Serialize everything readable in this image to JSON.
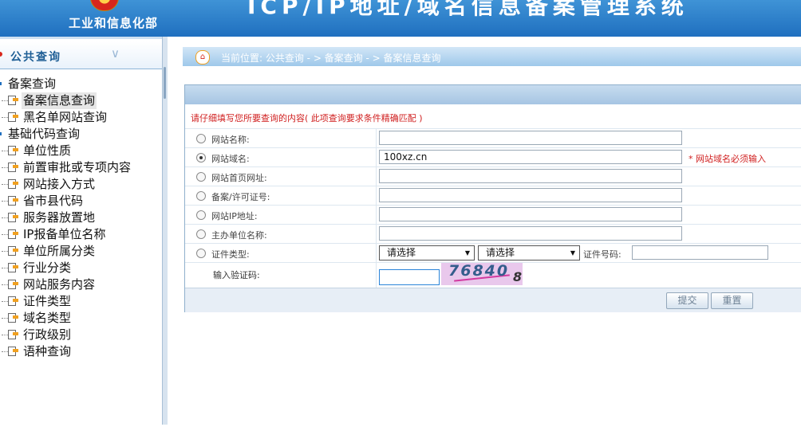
{
  "header": {
    "ministry": "工业和信息化部",
    "system_title": "ICP/IP地址/域名信息备案管理系统"
  },
  "sidebar": {
    "section_title": "公共查询",
    "groups": [
      {
        "label": "备案查询",
        "items": [
          {
            "label": "备案信息查询",
            "selected": true
          },
          {
            "label": "黑名单网站查询",
            "selected": false
          }
        ]
      },
      {
        "label": "基础代码查询",
        "items": [
          {
            "label": "单位性质"
          },
          {
            "label": "前置审批或专项内容"
          },
          {
            "label": "网站接入方式"
          },
          {
            "label": "省市县代码"
          },
          {
            "label": "服务器放置地"
          },
          {
            "label": "IP报备单位名称"
          },
          {
            "label": "单位所属分类"
          },
          {
            "label": "行业分类"
          },
          {
            "label": "网站服务内容"
          },
          {
            "label": "证件类型"
          },
          {
            "label": "域名类型"
          },
          {
            "label": "行政级别"
          },
          {
            "label": "语种查询"
          }
        ]
      }
    ]
  },
  "breadcrumb": "当前位置: 公共查询  - >  备案查询  - > 备案信息查询",
  "form": {
    "hint": "请仔细填写您所要查询的内容( 此项查询要求条件精确匹配 )",
    "rows": [
      {
        "label": "网站名称:",
        "value": "",
        "checked": false
      },
      {
        "label": "网站域名:",
        "value": "100xz.cn",
        "checked": true,
        "required_note": "* 网站域名必须输入"
      },
      {
        "label": "网站首页网址:",
        "value": "",
        "checked": false
      },
      {
        "label": "备案/许可证号:",
        "value": "",
        "checked": false
      },
      {
        "label": "网站IP地址:",
        "value": "",
        "checked": false
      },
      {
        "label": "主办单位名称:",
        "value": "",
        "checked": false
      }
    ],
    "cert_row": {
      "label": "证件类型:",
      "select1": "请选择",
      "select2": "请选择",
      "cert_no_label": "证件号码:",
      "cert_no_value": ""
    },
    "captcha": {
      "label": "输入验证码:",
      "input_value": "",
      "image_text": "76840",
      "image_extra": "8"
    },
    "buttons": {
      "submit": "提交",
      "reset": "重置"
    }
  },
  "colors": {
    "header_blue": "#1f6fbf",
    "required_red": "#d02020",
    "sidebar_title": "#1e5e95"
  }
}
